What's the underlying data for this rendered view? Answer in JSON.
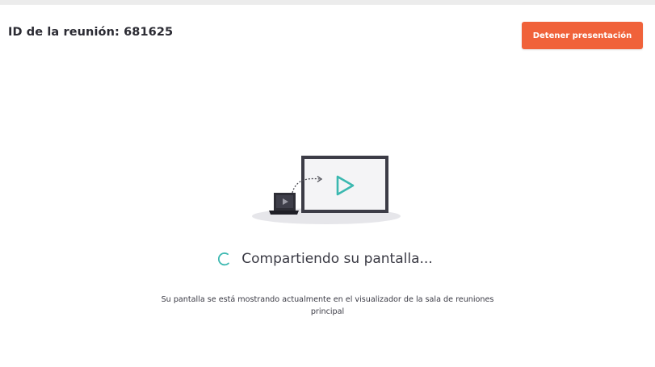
{
  "header": {
    "meeting_id_label": "ID de la reunión: 681625",
    "stop_button_label": "Detener presentación"
  },
  "main": {
    "illustration_icon": "screen-share-illustration",
    "spinner_icon": "loading-spinner-icon",
    "status_text": "Compartiendo su pantalla...",
    "description_line1": "Su pantalla se está mostrando actualmente en el visualizador de la sala de reuniones",
    "description_line2": "principal"
  },
  "colors": {
    "accent": "#f0623a",
    "teal": "#3bb8b0",
    "text": "#2b2b33"
  }
}
